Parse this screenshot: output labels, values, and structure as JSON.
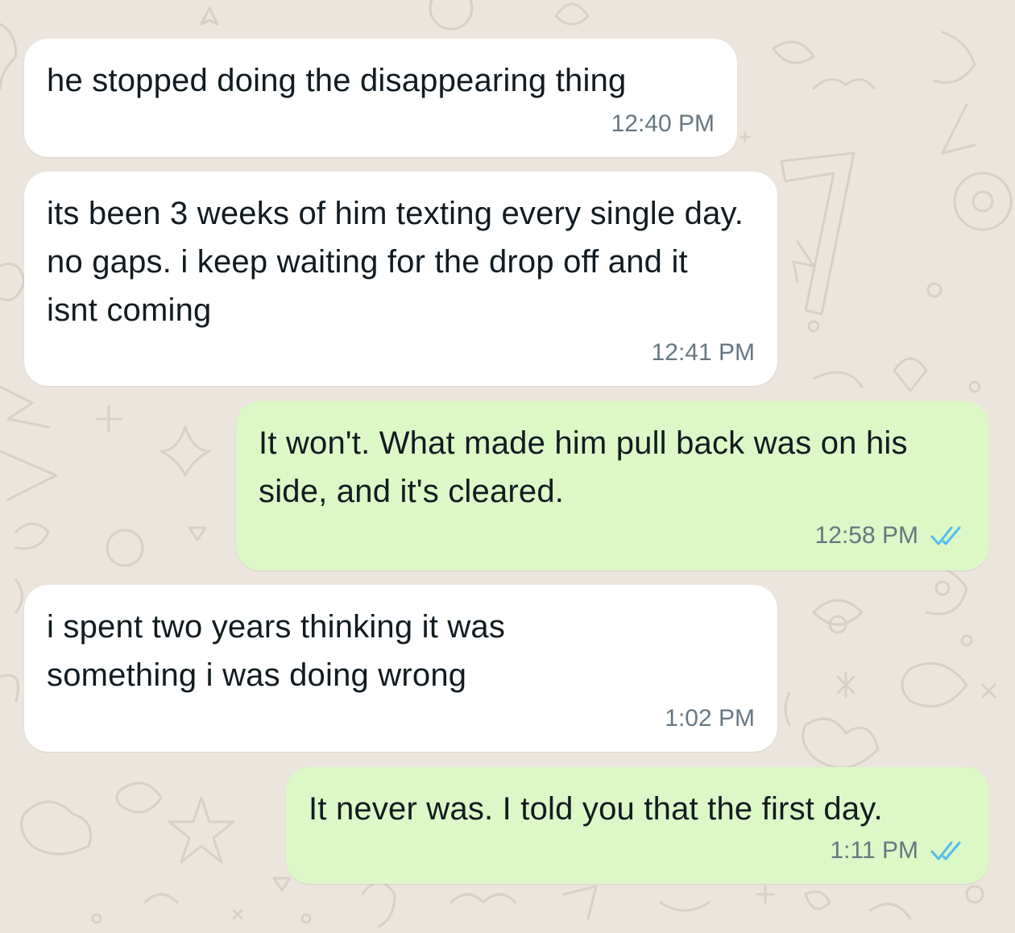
{
  "chat": {
    "messages": [
      {
        "direction": "incoming",
        "text": "he stopped doing the disappearing thing",
        "time": "12:40 PM"
      },
      {
        "direction": "incoming",
        "text": "its been 3 weeks of him texting every single day. no gaps. i keep waiting for the drop off and it isnt coming",
        "time": "12:41 PM"
      },
      {
        "direction": "outgoing",
        "text": "It won't. What made him pull back was on his side, and it's cleared.",
        "time": "12:58 PM",
        "status": "read"
      },
      {
        "direction": "incoming",
        "text": "i spent two years thinking it was something i was doing wrong",
        "time": "1:02 PM"
      },
      {
        "direction": "outgoing",
        "text": "It never was. I told you that the first day.",
        "time": "1:11 PM",
        "status": "read"
      }
    ]
  },
  "colors": {
    "wallpaper": "#ece5dd",
    "incoming_bubble": "#ffffff",
    "outgoing_bubble": "#dcf8c6",
    "read_ticks": "#53bdeb",
    "timestamp": "#667781"
  },
  "icons": {
    "read_receipt": "double-check-icon"
  }
}
